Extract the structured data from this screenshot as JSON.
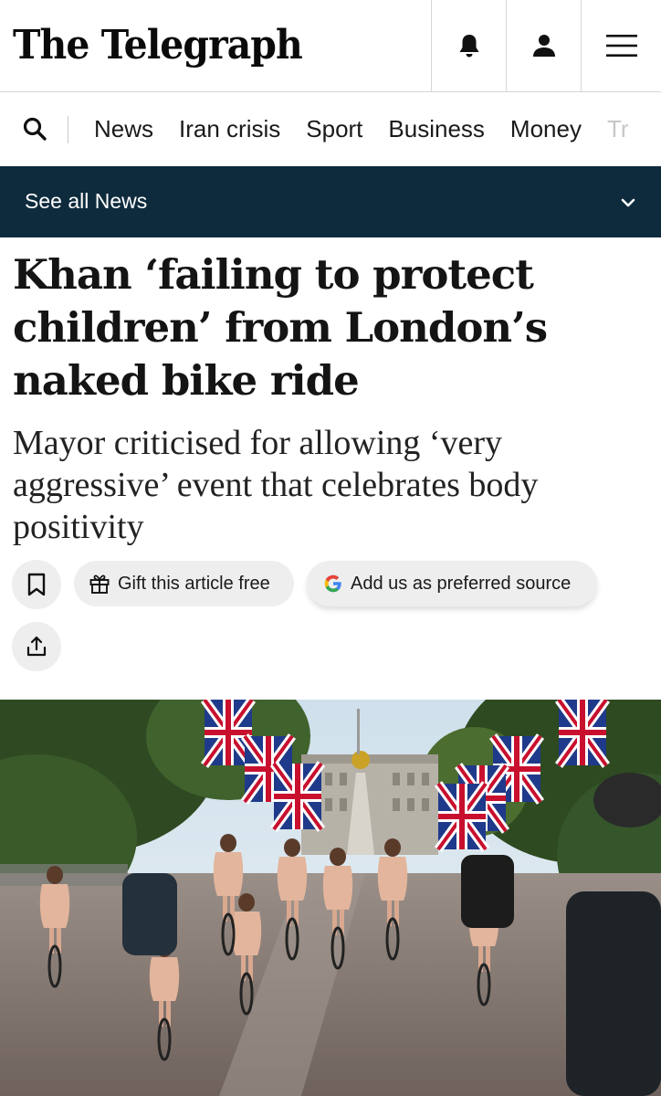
{
  "header": {
    "logo": "The Telegraph",
    "icons": [
      "bell-icon",
      "user-icon",
      "menu-icon"
    ]
  },
  "nav": {
    "items": [
      "News",
      "Iran crisis",
      "Sport",
      "Business",
      "Money",
      "Tr"
    ]
  },
  "section_bar": {
    "label": "See all News"
  },
  "article": {
    "headline": "Khan ‘failing to protect children’ from London’s naked bike ride",
    "standfirst": "Mayor criticised for allowing ‘very aggressive’ event that celebrates body positivity",
    "gift_label": "Gift this article free",
    "source_label": "Add us as preferred source"
  },
  "colors": {
    "section_bar_bg": "#0e2b3d",
    "button_bg": "#eeeeee"
  }
}
